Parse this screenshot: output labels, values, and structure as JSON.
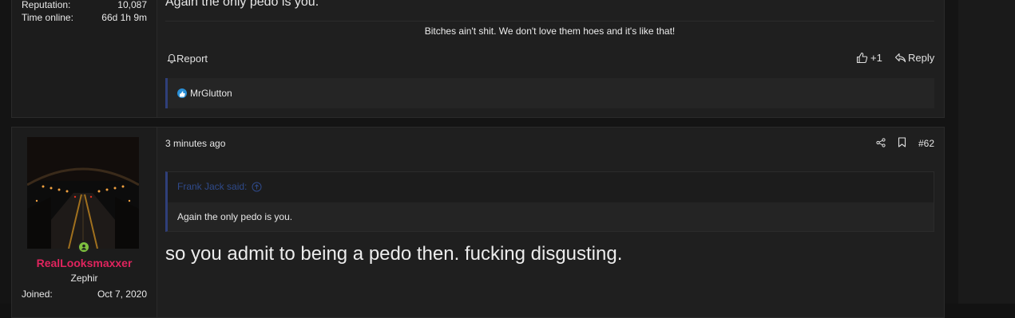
{
  "post1": {
    "stats": [
      {
        "key": "Reputation:",
        "value": "10,087"
      },
      {
        "key": "Time online:",
        "value": "66d 1h 9m"
      }
    ],
    "last_line": "Again the only pedo is you.",
    "signature": "Bitches ain't shit. We don't love them hoes and it's like that!",
    "report_label": "Report",
    "like_count": "+1",
    "reply_label": "Reply",
    "reaction_user": "MrGlutton"
  },
  "post2": {
    "username": "RealLooksmaxxer",
    "user_title": "Zephir",
    "stats": [
      {
        "key": "Joined:",
        "value": "Oct 7, 2020"
      }
    ],
    "time": "3 minutes ago",
    "post_number": "#62",
    "quote_author": "Frank Jack said:",
    "quote_text": "Again the only pedo is you.",
    "message": "so you admit to being a pedo then. fucking disgusting."
  },
  "colors": {
    "username": "#e0245e",
    "accent": "#2f3f7a",
    "online": "#7ec03f",
    "reaction": "#2a8fd6"
  },
  "icons": [
    "bell-icon",
    "thumbs-up-icon",
    "reply-icon",
    "reaction-like-icon",
    "share-icon",
    "bookmark-icon",
    "quote-up-arrow-icon",
    "online-status-icon"
  ]
}
